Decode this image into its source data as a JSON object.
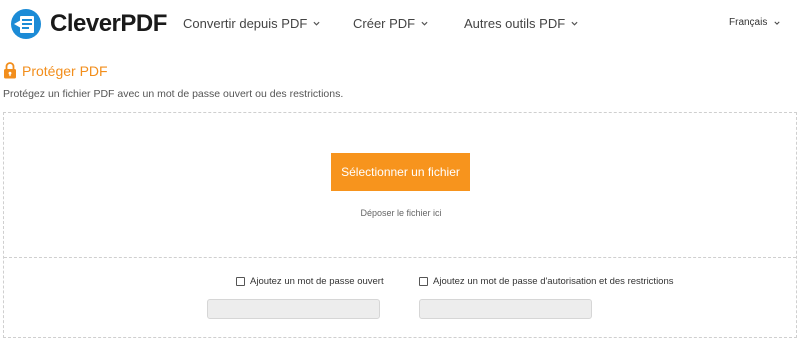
{
  "header": {
    "logo_text": "CleverPDF",
    "nav": [
      {
        "label": "Convertir depuis PDF"
      },
      {
        "label": "Créer PDF"
      },
      {
        "label": "Autres outils PDF"
      }
    ],
    "language": "Français"
  },
  "page": {
    "title": "Protéger PDF",
    "subtitle": "Protégez un fichier PDF avec un mot de passe ouvert ou des restrictions."
  },
  "upload": {
    "button_label": "Sélectionner un fichier",
    "drop_hint": "Déposer le fichier ici"
  },
  "options": {
    "open_password_label": "Ajoutez un mot de passe ouvert",
    "open_password_checked": false,
    "open_password_value": "",
    "permission_password_label": "Ajoutez un mot de passe d'autorisation et des restrictions",
    "permission_password_checked": false,
    "permission_password_value": ""
  },
  "colors": {
    "accent": "#f7941d",
    "brand_blue": "#1c8bd6"
  },
  "icons": [
    "cleverpdf-logo-icon",
    "chevron-down-icon",
    "lock-icon",
    "checkbox-icon"
  ]
}
